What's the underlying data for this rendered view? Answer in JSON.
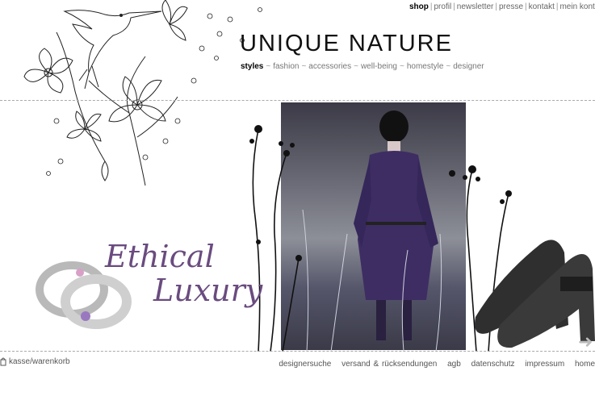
{
  "top_nav": [
    {
      "label": "shop",
      "active": true
    },
    {
      "label": "profil"
    },
    {
      "label": "newsletter"
    },
    {
      "label": "presse"
    },
    {
      "label": "kontakt"
    },
    {
      "label": "mein konto"
    }
  ],
  "logo": "UNIQUE NATURE",
  "category_nav": [
    {
      "label": "styles",
      "active": true
    },
    {
      "label": "fashion"
    },
    {
      "label": "accessories"
    },
    {
      "label": "well-being"
    },
    {
      "label": "homestyle"
    },
    {
      "label": "designer"
    }
  ],
  "promo": {
    "line1": "Ethical",
    "line2": "Luxury"
  },
  "basket_label": "kasse/warenkorb",
  "footer_nav": [
    "designersuche",
    "versand & rücksendungen",
    "agb",
    "datenschutz",
    "impressum",
    "home"
  ],
  "colors": {
    "accent_purple": "#6a4b7f",
    "text_gray": "#666666"
  }
}
